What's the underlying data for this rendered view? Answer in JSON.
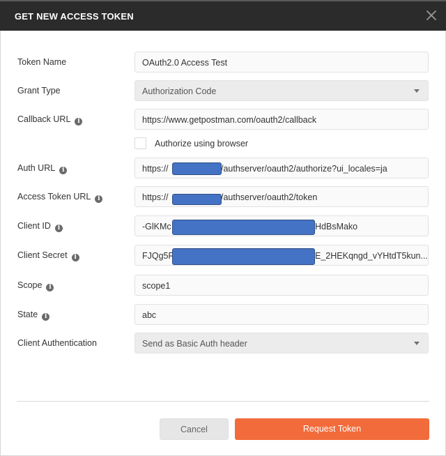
{
  "dialog": {
    "title": "GET NEW ACCESS TOKEN",
    "close_glyph": "close-icon"
  },
  "fields": {
    "token_name": {
      "label": "Token Name",
      "value": "OAuth2.0 Access Test"
    },
    "grant_type": {
      "label": "Grant Type",
      "value": "Authorization Code"
    },
    "callback_url": {
      "label": "Callback URL",
      "value": "https://www.getpostman.com/oauth2/callback"
    },
    "authorize_browser": {
      "label": "Authorize using browser",
      "checked": false
    },
    "auth_url": {
      "label": "Auth URL",
      "value_prefix": "https://",
      "value_suffix": "/authserver/oauth2/authorize?ui_locales=ja"
    },
    "access_token_url": {
      "label": "Access Token URL",
      "value_prefix": "https://",
      "value_suffix": "/authserver/oauth2/token"
    },
    "client_id": {
      "label": "Client ID",
      "value_prefix": "-GlKMc",
      "value_suffix": "HdBsMako"
    },
    "client_secret": {
      "label": "Client Secret",
      "value_prefix": "FJQg5R",
      "value_suffix": "E_2HEKqngd_vYHtdT5kun..."
    },
    "scope": {
      "label": "Scope",
      "value": "scope1"
    },
    "state": {
      "label": "State",
      "value": "abc"
    },
    "client_auth": {
      "label": "Client Authentication",
      "value": "Send as Basic Auth header"
    }
  },
  "info_glyph": "i",
  "buttons": {
    "cancel": "Cancel",
    "request": "Request Token"
  },
  "colors": {
    "titlebar": "#2b2b2b",
    "primary": "#f26b3a",
    "redaction": "#4472c4"
  }
}
